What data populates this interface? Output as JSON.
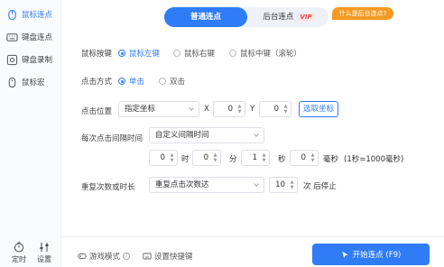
{
  "sidebar": {
    "items": [
      {
        "label": "鼠标连点",
        "icon": "mouse-click-icon",
        "active": true
      },
      {
        "label": "键盘连点",
        "icon": "keyboard-icon",
        "active": false
      },
      {
        "label": "键盘录制",
        "icon": "keyboard-record-icon",
        "active": false
      },
      {
        "label": "鼠标宏",
        "icon": "mouse-icon",
        "active": false
      }
    ],
    "bottom": [
      {
        "label": "定时",
        "icon": "timer-icon"
      },
      {
        "label": "设置",
        "icon": "settings-icon"
      }
    ]
  },
  "tabs": {
    "normal": "普通连点",
    "background": "后台连点",
    "vip_badge": "VIP"
  },
  "whatis_badge": "什么是后台连点?",
  "mouse_button": {
    "label": "鼠标按键",
    "options": [
      "鼠标左键",
      "鼠标右键",
      "鼠标中键（滚轮）"
    ],
    "selected": 0
  },
  "click_mode": {
    "label": "点击方式",
    "options": [
      "单击",
      "双击"
    ],
    "selected": 0
  },
  "click_position": {
    "label": "点击位置",
    "select_value": "指定坐标",
    "x_label": "X",
    "x_value": "0",
    "y_label": "Y",
    "y_value": "0",
    "pick_button": "选取坐标"
  },
  "interval": {
    "label": "每次点击间隔时间",
    "select_value": "自定义间隔时间",
    "hours": "0",
    "hours_unit": "时",
    "minutes": "0",
    "minutes_unit": "分",
    "seconds": "1",
    "seconds_unit": "秒",
    "ms": "0",
    "ms_unit": "毫秒",
    "note": "(1秒=1000毫秒)"
  },
  "repeat": {
    "label": "重复次数或时长",
    "select_value": "重复点击次数达",
    "count": "10",
    "suffix": "次 后停止"
  },
  "footer": {
    "game_mode": "游戏模式",
    "shortcut": "设置快捷键",
    "start_button": "开始连点 (F9)"
  },
  "colors": {
    "accent": "#2f7cf6",
    "vip": "#e24b4b",
    "badge": "#f59a23"
  }
}
